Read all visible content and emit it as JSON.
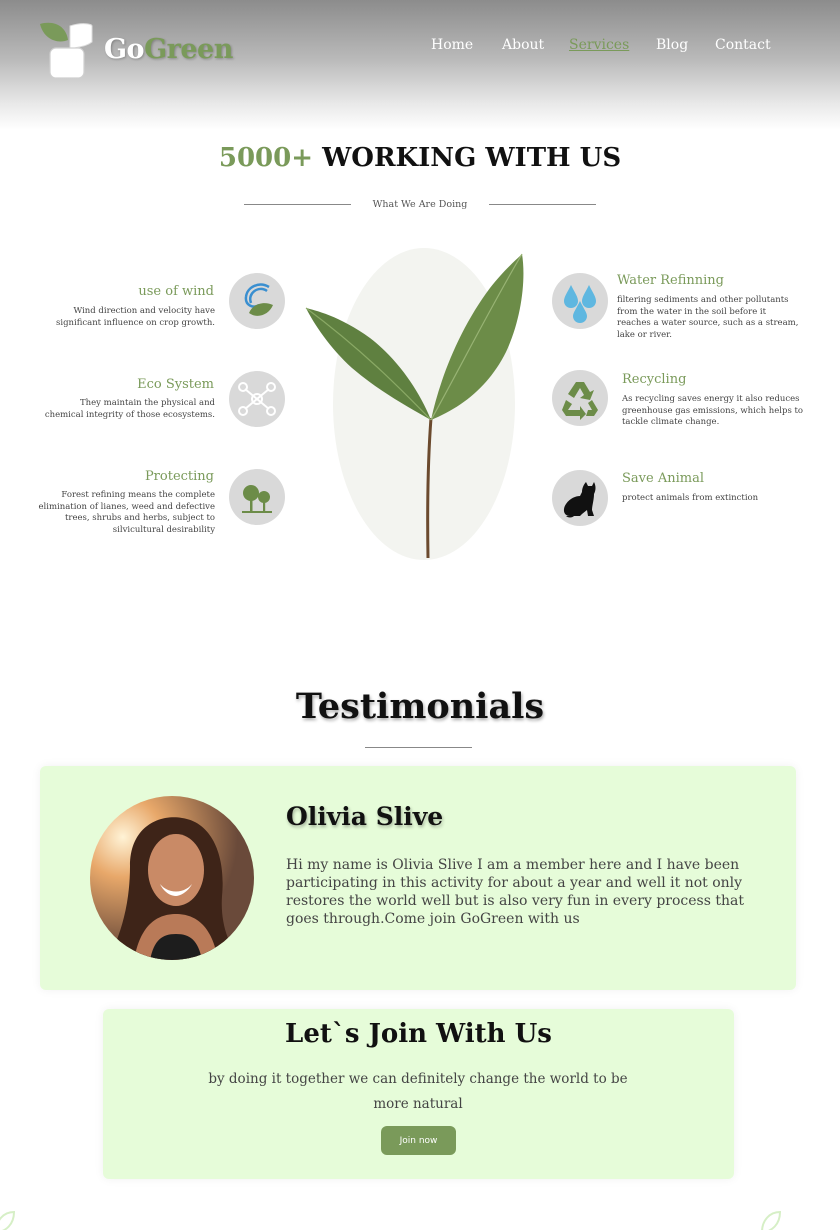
{
  "header": {
    "logo": {
      "part1": "Go",
      "part2": "Green"
    },
    "nav": [
      {
        "label": "Home",
        "active": false
      },
      {
        "label": "About",
        "active": false
      },
      {
        "label": "Services",
        "active": true
      },
      {
        "label": "Blog",
        "active": false
      },
      {
        "label": "Contact",
        "active": false
      }
    ]
  },
  "working": {
    "count": "5000+",
    "title": "WORKING WITH US",
    "subtitle": "What We Are Doing",
    "left_features": [
      {
        "title": "use of wind",
        "desc": "Wind direction and velocity have significant influence on crop growth.",
        "icon": "wind-leaf-icon"
      },
      {
        "title": "Eco System",
        "desc": "They maintain the physical and chemical integrity of those ecosystems.",
        "icon": "network-icon"
      },
      {
        "title": "Protecting",
        "desc": "Forest refining means the complete elimination of lianes, weed and defective trees, shrubs and herbs, subject to silvicultural desirability",
        "icon": "trees-icon"
      }
    ],
    "right_features": [
      {
        "title": "Water Refinning",
        "desc": " filtering sediments and other pollutants from the water in the soil before it reaches a water source, such as a stream, lake or river.",
        "icon": "water-drops-icon"
      },
      {
        "title": "Recycling",
        "desc": "As recycling saves energy it also reduces greenhouse gas emissions, which helps to tackle climate change.",
        "icon": "recycle-icon"
      },
      {
        "title": "Save Animal",
        "desc": "protect animals from extinction",
        "icon": "cat-icon"
      }
    ]
  },
  "testimonials": {
    "title": "Testimonials",
    "items": [
      {
        "name": "Olivia Slive",
        "text": "Hi my name is Olivia Slive I am a member here and I have been participating in this activity for about a year and well it not only restores the world well but is also very fun in every process that goes through.Come join GoGreen with us"
      }
    ]
  },
  "join": {
    "title": "Let`s Join With Us",
    "text": "by doing it together we can definitely change the world to be more natural",
    "button": "Join now"
  },
  "colors": {
    "accent": "#7a9a5a",
    "card_bg": "#e6fcd9",
    "icon_bg": "#d9d9d9"
  }
}
